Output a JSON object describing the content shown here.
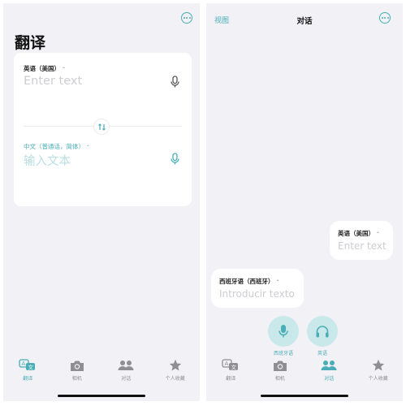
{
  "left": {
    "title": "翻译",
    "source": {
      "language": "英语（美国）",
      "placeholder": "Enter text"
    },
    "target": {
      "language": "中文（普通话，简体）",
      "placeholder": "输入文本"
    }
  },
  "right": {
    "nav_left": "视图",
    "nav_title": "对话",
    "bubble_top": {
      "language": "英语（美国）",
      "placeholder": "Enter text"
    },
    "bubble_bottom": {
      "language": "西班牙语（西班牙）",
      "placeholder": "Introducir texto"
    },
    "mic_buttons": [
      {
        "label": "西班牙语",
        "icon": "microphone-icon"
      },
      {
        "label": "英语",
        "icon": "headphones-icon"
      }
    ]
  },
  "tabbar": {
    "items": [
      {
        "label": "翻译",
        "icon": "translate-icon"
      },
      {
        "label": "相机",
        "icon": "camera-icon"
      },
      {
        "label": "对话",
        "icon": "people-icon"
      },
      {
        "label": "个人收藏",
        "icon": "star-icon"
      }
    ]
  },
  "colors": {
    "accent": "#4aaeb8",
    "background": "#f2f1f6",
    "inactive": "#8e8e93"
  }
}
